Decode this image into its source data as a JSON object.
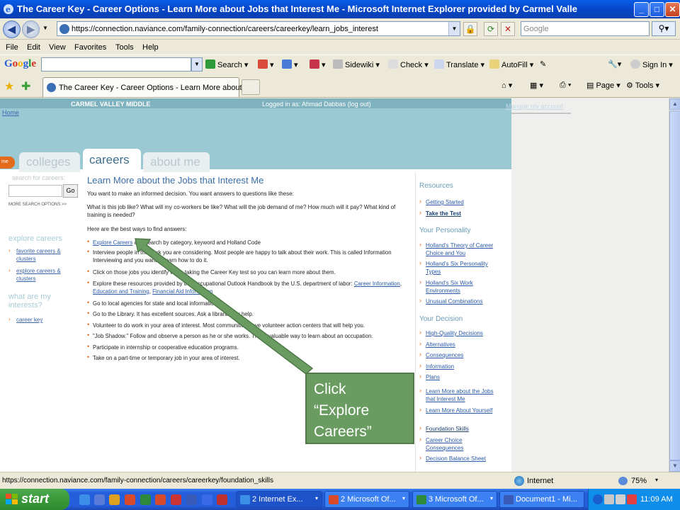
{
  "window": {
    "title": "The Career Key - Career Options - Learn More about Jobs that Interest Me - Microsoft Internet Explorer provided by Carmel Valle",
    "min": "_",
    "max": "□",
    "close": "✕"
  },
  "address": {
    "url": "https://connection.naviance.com/family-connection/careers/careerkey/learn_jobs_interest",
    "search_placeholder": "Google"
  },
  "menu": [
    "File",
    "Edit",
    "View",
    "Favorites",
    "Tools",
    "Help"
  ],
  "google_toolbar": {
    "logo": "Google",
    "search_label": "Search",
    "sidewiki": "Sidewiki",
    "check": "Check",
    "translate": "Translate",
    "autofill": "AutoFill",
    "signin": "Sign In"
  },
  "tab": {
    "label": "The Career Key - Career Options - Learn More about ...",
    "page": "Page",
    "tools": "Tools"
  },
  "site": {
    "school": "CARMEL VALLEY MIDDLE",
    "logged_in": "Logged in as: Ahmad Dabbas (log out)",
    "home": "Home",
    "manage_account": "Manage my account",
    "pill": "me",
    "tabs": {
      "colleges": "colleges",
      "careers": "careers",
      "about": "about me"
    }
  },
  "left": {
    "search_label": "search for careers:",
    "go": "Go",
    "more": "MORE SEARCH OPTIONS >>",
    "explore_head": "explore careers",
    "fav": "favorite careers & clusters",
    "explore": "explore careers & clusters",
    "interests_head": "what are my interests?",
    "career_key": "career key"
  },
  "main": {
    "title": "Learn More about the Jobs that Interest Me",
    "p1": "You want to make an informed decision. You want answers to questions like these:",
    "p2": "What is this job like? What will my co-workers be like? What will the job demand of me? How much will it pay? What kind of training is needed?",
    "p3": "Here are the best ways to find answers:",
    "b1_link": "Explore Careers",
    "b1_rest": " and search by category, keyword and Holland Code",
    "b2": "Interview people in the work you are considering. Most people are happy to talk about their work. This is called Information Interviewing and you want to learn how to do it.",
    "b3": "Click on those jobs you identify when taking the Career Key test so you can learn more about them.",
    "b4_text": "Explore these resources provided by the Occupational Outlook Handbook by the U.S. department of labor: ",
    "b4_l1": "Career Information",
    "b4_l2": "Education and Training",
    "b4_l3": "Financial Aid Information",
    "b5": "Go to local agencies for state and local information",
    "b6": "Go to the Library. It has excellent sources. Ask a librarian for help.",
    "b7": "Volunteer to do work in your area of interest. Most communities have volunteer action centers that will help you.",
    "b8": "\"Job Shadow.\" Follow and observe a person as he or she works. This a valuable way to learn about an occupation.",
    "b9": "Participate in internship or cooperative education programs.",
    "b10": "Take on a part-time or temporary job in your area of interest."
  },
  "resources": {
    "head1": "Resources",
    "r1": "Getting Started",
    "r2": "Take the Test",
    "head2": "Your Personality",
    "r3": "Holland's Theory of Career Choice and You",
    "r4": "Holland's Six Personality Types",
    "r5": "Holland's Six Work Environments",
    "r6": "Unusual Combinations",
    "head3": "Your Decision",
    "r7": "High-Quality Decisions",
    "r8": "Alternatives",
    "r9": "Consequences",
    "r10": "Information",
    "r11": "Plans",
    "r12": "Learn More about the Jobs that Interest Me",
    "r13": "Learn More About Yourself",
    "r14": "Foundation Skills",
    "r15": "Career Choice Consequences",
    "r16": "Decision Balance Sheet"
  },
  "callout": {
    "line1": "Click",
    "line2": "“Explore",
    "line3": "Careers”"
  },
  "status": {
    "url": "https://connection.naviance.com/family-connection/careers/careerkey/foundation_skills",
    "zone": "Internet",
    "zoom": "75%"
  },
  "taskbar": {
    "start": "start",
    "b1": "2 Internet Ex...",
    "b2": "2 Microsoft Of...",
    "b3": "3 Microsoft Of...",
    "b4": "Document1 - Mi...",
    "clock": "11:09 AM"
  },
  "colors": {
    "header_teal": "#9ac9d3",
    "accent_orange": "#e36b1b",
    "link_blue": "#2a5aa8",
    "callout_green": "#6a9c62"
  }
}
